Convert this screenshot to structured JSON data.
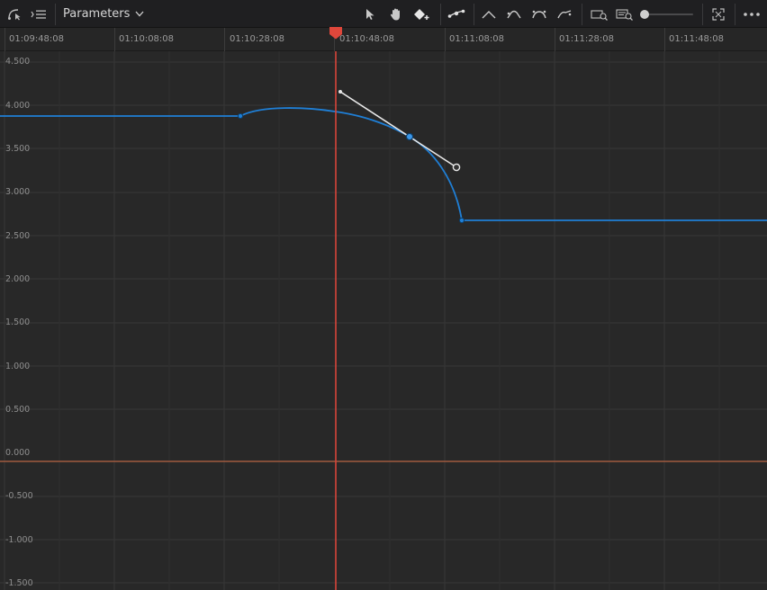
{
  "toolbar": {
    "curve_tool_icon": "curve-select-icon",
    "list_icon": "keyframe-list-icon",
    "dropdown_label": "Parameters",
    "tools": [
      "pointer-icon",
      "hand-icon",
      "add-keyframe-icon",
      "linear-curve-icon",
      "ease-in-icon",
      "ease-out-icon",
      "ease-in-out-icon",
      "custom-ease-icon",
      "zoom-fit-keyframes-icon",
      "zoom-fit-window-icon",
      "fullscreen-icon",
      "more-options-icon"
    ],
    "zoom_slider_level": 0.0
  },
  "ruler": {
    "timecodes": [
      "01:09:48:08",
      "01:10:08:08",
      "01:10:28:08",
      "01:10:48:08",
      "01:11:08:08",
      "01:11:28:08",
      "01:11:48:08"
    ]
  },
  "graph": {
    "y_labels": [
      "4.500",
      "4.000",
      "3.500",
      "3.000",
      "2.500",
      "2.000",
      "1.500",
      "1.000",
      "0.500",
      "0.000",
      "-0.500",
      "-1.000",
      "-1.500"
    ],
    "colors": {
      "curve": "#1f7fd6",
      "playhead": "#d8453a",
      "zero_line": "#a05a3f",
      "handle": "#e8e8e8",
      "grid": "#383838",
      "background": "#282828"
    },
    "keyframes": [
      {
        "time": "01:10:28:08",
        "value": 3.92
      },
      {
        "time": "01:10:56:08",
        "value": 3.68,
        "selected": true
      },
      {
        "time": "01:11:09:08",
        "value": 2.72
      }
    ],
    "playhead_time": "01:10:48:08"
  }
}
